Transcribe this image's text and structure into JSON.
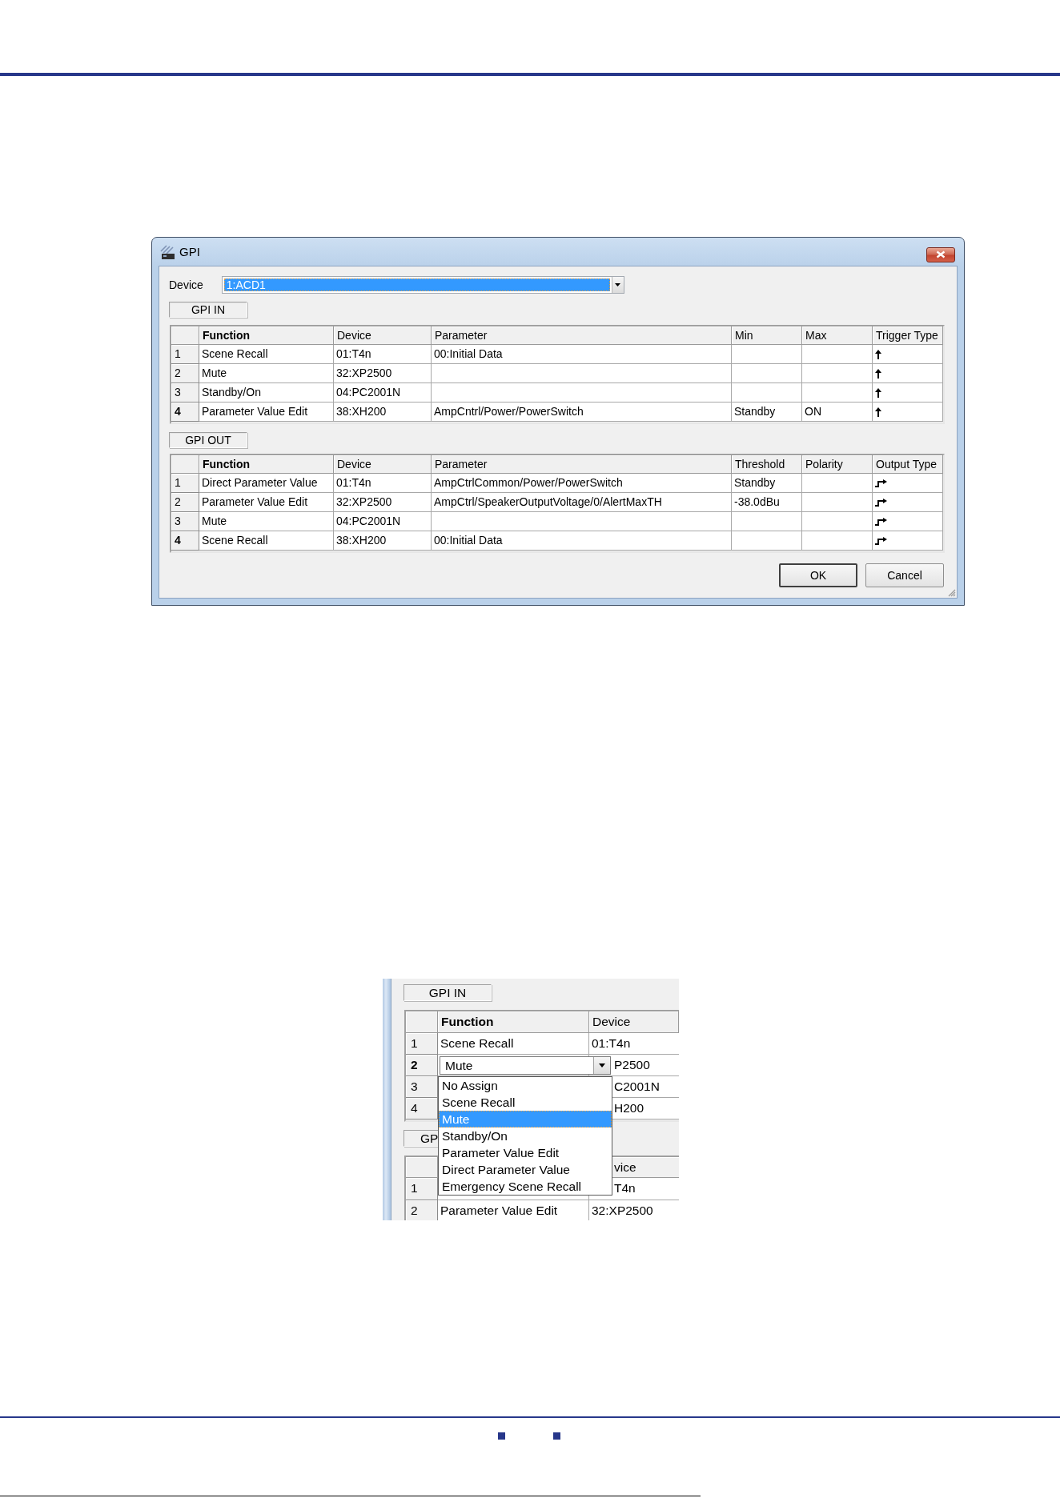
{
  "dialog": {
    "title": "GPI",
    "device_label": "Device",
    "device": {
      "value": "1:ACD1",
      "focused": true
    },
    "sections": [
      {
        "kind": "in",
        "label": "GPI IN",
        "columns": [
          "Function",
          "Device",
          "Parameter",
          "Min",
          "Max",
          "Trigger Type"
        ],
        "rows": [
          {
            "number": "1",
            "selected": false,
            "cells": [
              "Scene Recall",
              "01:T4n",
              "00:Initial Data"
            ]
          },
          {
            "number": "2",
            "selected": false,
            "cells": [
              "Mute",
              "32:XP2500"
            ]
          },
          {
            "number": "3",
            "selected": false,
            "cells": [
              "Standby/On",
              "04:PC2001N"
            ]
          },
          {
            "number": "4",
            "selected": true,
            "cells": [
              "Parameter Value Edit",
              "38:XH200",
              "AmpCntrl/Power/PowerSwitch",
              "Standby",
              "ON"
            ]
          }
        ]
      },
      {
        "kind": "out",
        "label": "GPI OUT",
        "columns": [
          "Function",
          "Device",
          "Parameter",
          "Threshold",
          "Polarity",
          "Output Type"
        ],
        "rows": [
          {
            "number": "1",
            "selected": false,
            "cells": [
              "Direct Parameter Value",
              "01:T4n",
              "AmpCtrlCommon/Power/PowerSwitch",
              "Standby"
            ]
          },
          {
            "number": "2",
            "selected": false,
            "cells": [
              "Parameter Value Edit",
              "32:XP2500",
              "AmpCtrl/SpeakerOutputVoltage/0/AlertMaxTH",
              "-38.0dBu"
            ]
          },
          {
            "number": "3",
            "selected": false,
            "cells": [
              "Mute",
              "04:PC2001N"
            ]
          },
          {
            "number": "4",
            "selected": true,
            "cells": [
              "Scene Recall",
              "38:XH200",
              "00:Initial Data"
            ]
          }
        ]
      }
    ],
    "buttons": [
      {
        "label": "OK",
        "default": true
      },
      {
        "label": "Cancel",
        "default": false
      }
    ]
  },
  "inset": {
    "section_label": "GPI IN",
    "columns": [
      "Function",
      "Device"
    ],
    "rows": [
      {
        "number": "1",
        "selected": false,
        "function": "Scene Recall",
        "device": "01:T4n",
        "partly_hidden": false
      },
      {
        "number": "2",
        "selected": true,
        "device": "P2500",
        "partly_hidden": true,
        "editor": {
          "value": "Mute",
          "expanded": true,
          "options": [
            {
              "label": "No Assign",
              "selected": false
            },
            {
              "label": "Scene Recall",
              "selected": false
            },
            {
              "label": "Mute",
              "selected": true
            },
            {
              "label": "Standby/On",
              "selected": false
            },
            {
              "label": "Parameter Value Edit",
              "selected": false
            },
            {
              "label": "Direct Parameter Value",
              "selected": false
            },
            {
              "label": "Emergency Scene Recall",
              "selected": false
            }
          ]
        }
      },
      {
        "number": "3",
        "selected": false,
        "device": "C2001N",
        "partly_hidden": true
      },
      {
        "number": "4",
        "selected": false,
        "device": "H200",
        "partly_hidden": true
      }
    ],
    "lower_section_label": "GP",
    "lower_table": {
      "device_header": {
        "label": "vice",
        "partly_hidden": true
      },
      "rows": [
        {
          "number": "1",
          "selected": false,
          "device": "T4n",
          "partly_hidden": true
        },
        {
          "number": "2",
          "selected": false,
          "function": "Parameter Value Edit",
          "device": "32:XP2500",
          "partly_hidden": false
        }
      ]
    }
  }
}
